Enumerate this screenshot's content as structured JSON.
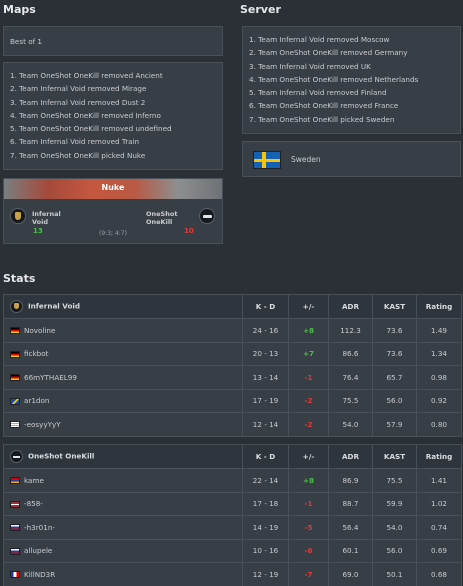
{
  "maps": {
    "title": "Maps",
    "format": "Best of 1",
    "veto": [
      "1. Team OneShot OneKill removed Ancient",
      "2. Team Infernal Void removed Mirage",
      "3. Team Infernal Void removed Dust 2",
      "4. Team OneShot OneKill removed Inferno",
      "5. Team OneShot OneKill removed undefined",
      "6. Team Infernal Void removed Train",
      "7. Team OneShot OneKill picked Nuke"
    ],
    "result": {
      "map_name": "Nuke",
      "team1_name_line1": "Infernal",
      "team1_name_line2": "Void",
      "team1_score": "13",
      "team2_name_line1": "OneShot",
      "team2_name_line2": "OneKill",
      "team2_score": "10",
      "halves": "(9:3; 4:7)"
    }
  },
  "server": {
    "title": "Server",
    "veto": [
      "1. Team Infernal Void removed Moscow",
      "2. Team OneShot OneKill removed Germany",
      "3. Team Infernal Void removed UK",
      "4. Team OneShot OneKill removed Netherlands",
      "5. Team Infernal Void removed Finland",
      "6. Team OneShot OneKill removed France",
      "7. Team OneShot OneKill picked Sweden"
    ],
    "selected": "Sweden"
  },
  "stats": {
    "title": "Stats",
    "columns": [
      "K - D",
      "+/-",
      "ADR",
      "KAST",
      "Rating"
    ],
    "team1": {
      "name": "Infernal Void",
      "players": [
        {
          "name": "Novoline",
          "flag": "de",
          "kd": "24 - 16",
          "diff": "+8",
          "adr": "112.3",
          "kast": "73.6",
          "rating": "1.49"
        },
        {
          "name": "fickbot",
          "flag": "de",
          "kd": "20 - 13",
          "diff": "+7",
          "adr": "86.6",
          "kast": "73.6",
          "rating": "1.34"
        },
        {
          "name": "66mYTHAEL99",
          "flag": "de",
          "kd": "13 - 14",
          "diff": "-1",
          "adr": "76.4",
          "kast": "65.7",
          "rating": "0.98"
        },
        {
          "name": "ar1don",
          "flag": "ba",
          "kd": "17 - 19",
          "diff": "-2",
          "adr": "75.5",
          "kast": "56.0",
          "rating": "0.92"
        },
        {
          "name": "-eosyyYyY",
          "flag": "il",
          "kd": "12 - 14",
          "diff": "-2",
          "adr": "54.0",
          "kast": "57.9",
          "rating": "0.80"
        }
      ]
    },
    "team2": {
      "name": "OneShot OneKill",
      "players": [
        {
          "name": "kame",
          "flag": "am",
          "kd": "22 - 14",
          "diff": "+8",
          "adr": "86.9",
          "kast": "75.5",
          "rating": "1.41"
        },
        {
          "name": "-858-",
          "flag": "lv",
          "kd": "17 - 18",
          "diff": "-1",
          "adr": "88.7",
          "kast": "59.9",
          "rating": "1.02"
        },
        {
          "name": "-h3r01n-",
          "flag": "ru",
          "kd": "14 - 19",
          "diff": "-5",
          "adr": "56.4",
          "kast": "54.0",
          "rating": "0.74"
        },
        {
          "name": "allupele",
          "flag": "ru",
          "kd": "10 - 16",
          "diff": "-6",
          "adr": "60.1",
          "kast": "56.0",
          "rating": "0.69"
        },
        {
          "name": "KillND3R",
          "flag": "fr",
          "kd": "12 - 19",
          "diff": "-7",
          "adr": "69.0",
          "kast": "50.1",
          "rating": "0.68"
        }
      ]
    }
  }
}
